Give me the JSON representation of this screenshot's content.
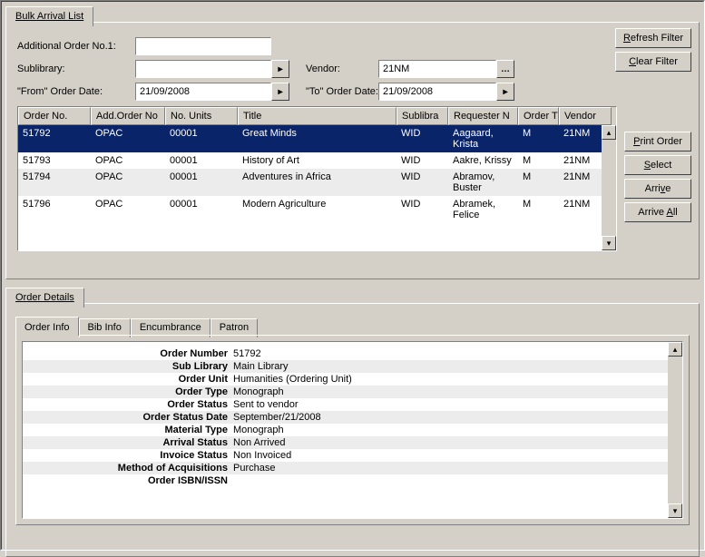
{
  "topTab": "Bulk Arrival List",
  "filters": {
    "addOrderLabel": "Additional Order No.1:",
    "addOrderValue": "",
    "sublibraryLabel": "Sublibrary:",
    "sublibraryValue": "",
    "vendorLabel": "Vendor:",
    "vendorValue": "21NM",
    "fromDateLabel": "\"From\" Order Date:",
    "fromDateValue": "21/09/2008",
    "toDateLabel": "\"To\" Order Date:",
    "toDateValue": "21/09/2008"
  },
  "sideButtons": {
    "refresh": {
      "pre": "",
      "accel": "R",
      "post": "efresh Filter"
    },
    "clear": {
      "pre": "",
      "accel": "C",
      "post": "lear Filter"
    },
    "print": {
      "pre": "",
      "accel": "P",
      "post": "rint Order"
    },
    "select": {
      "pre": "",
      "accel": "S",
      "post": "elect"
    },
    "arrive": {
      "pre": "Arri",
      "accel": "v",
      "post": "e"
    },
    "arriveAll": {
      "pre": "Arrive ",
      "accel": "A",
      "post": "ll"
    }
  },
  "columns": [
    "Order No.",
    "Add.Order No",
    "No. Units",
    "Title",
    "Sublibra",
    "Requester N",
    "Order T",
    "Vendor"
  ],
  "rows": [
    {
      "sel": true,
      "alt": false,
      "cells": [
        "51792",
        "OPAC",
        "00001",
        "Great Minds",
        "WID",
        "Aagaard, Krista",
        "M",
        "21NM"
      ]
    },
    {
      "sel": false,
      "alt": false,
      "cells": [
        "51793",
        "OPAC",
        "00001",
        "History of Art",
        "WID",
        "Aakre, Krissy",
        "M",
        "21NM"
      ]
    },
    {
      "sel": false,
      "alt": true,
      "cells": [
        "51794",
        "OPAC",
        "00001",
        "Adventures in Africa",
        "WID",
        "Abramov, Buster",
        "M",
        "21NM"
      ]
    },
    {
      "sel": false,
      "alt": false,
      "cells": [
        "51796",
        "OPAC",
        "00001",
        "Modern Agriculture",
        "WID",
        "Abramek, Felice",
        "M",
        "21NM"
      ]
    }
  ],
  "bottomTab": "Order Details",
  "innerTabs": [
    "Order Info",
    "Bib Info",
    "Encumbrance",
    "Patron"
  ],
  "innerActive": 0,
  "details": [
    {
      "k": "Order Number",
      "v": "51792"
    },
    {
      "k": "Sub Library",
      "v": "Main Library"
    },
    {
      "k": "Order Unit",
      "v": "Humanities (Ordering Unit)"
    },
    {
      "k": "Order Type",
      "v": "Monograph"
    },
    {
      "k": "Order Status",
      "v": "Sent to vendor"
    },
    {
      "k": "Order Status Date",
      "v": "September/21/2008"
    },
    {
      "k": "Material Type",
      "v": "Monograph"
    },
    {
      "k": "Arrival Status",
      "v": "Non Arrived"
    },
    {
      "k": "Invoice Status",
      "v": "Non Invoiced"
    },
    {
      "k": "Method of Acquisitions",
      "v": "Purchase"
    },
    {
      "k": "Order ISBN/ISSN",
      "v": ""
    }
  ]
}
